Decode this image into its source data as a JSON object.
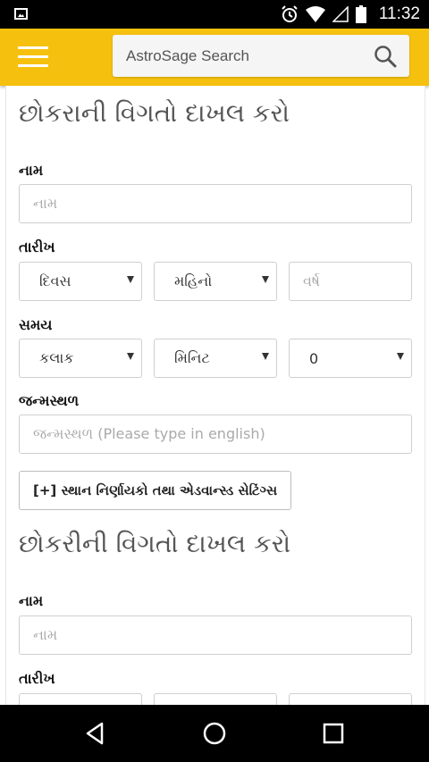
{
  "status_bar": {
    "time": "11:32",
    "icons": [
      "image-icon",
      "alarm-icon",
      "wifi-icon",
      "signal-icon",
      "battery-icon"
    ]
  },
  "app_bar": {
    "color": "#f6c10e",
    "search_placeholder": "AstroSage Search"
  },
  "boy_section": {
    "title": "છોકરાની વિગતો દાખલ કરો",
    "name_label": "નામ",
    "name_placeholder": "નામ",
    "date_label": "તારીખ",
    "day_select": "દિવસ",
    "month_select": "મહિનો",
    "year_placeholder": "વર્ષ",
    "time_label": "સમય",
    "hour_select": "કલાક",
    "minute_select": "મિનિટ",
    "second_select": "0",
    "birthplace_label": "જન્મસ્થળ",
    "birthplace_placeholder": "જન્મસ્થળ (Please type in english)",
    "advanced_button": "[+] સ્થાન નિર્ણાયકો તથા એડવાન્સ્ડ સેટિંગ્સ"
  },
  "girl_section": {
    "title": "છોકરીની વિગતો દાખલ કરો",
    "name_label": "નામ",
    "name_placeholder": "નામ",
    "date_label": "તારીખ"
  },
  "nav_bar": {
    "buttons": [
      "back-icon",
      "home-icon",
      "recents-icon"
    ]
  }
}
